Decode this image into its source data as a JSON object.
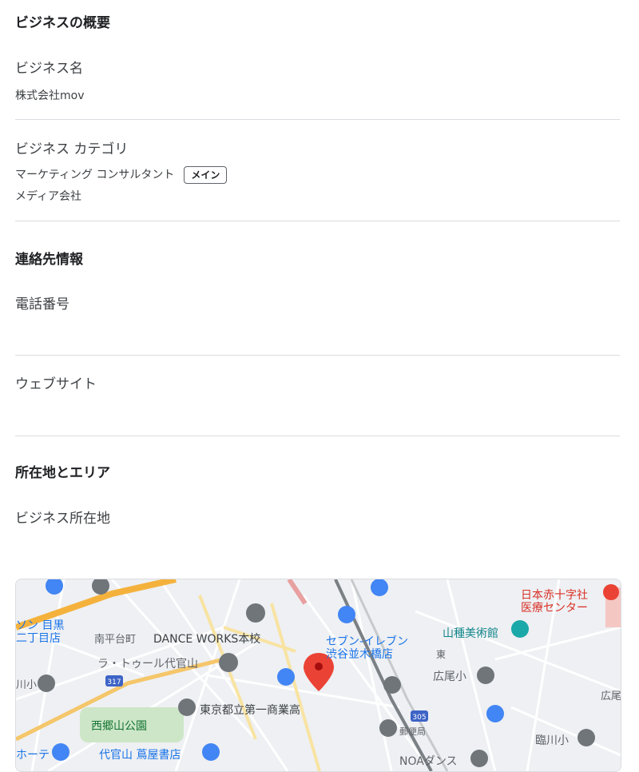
{
  "overview": {
    "title": "ビジネスの概要",
    "business_name_label": "ビジネス名",
    "business_name_value": "株式会社mov",
    "category_label": "ビジネス カテゴリ",
    "primary_category": "マーケティング コンサルタント",
    "primary_badge": "メイン",
    "secondary_category": "メディア会社"
  },
  "contact": {
    "title": "連絡先情報",
    "phone_label": "電話番号",
    "website_label": "ウェブサイト"
  },
  "location": {
    "title": "所在地とエリア",
    "address_label": "ビジネス所在地"
  },
  "map": {
    "labels": {
      "red_cross": "日本赤十字社",
      "red_cross_2": "医療センター",
      "meguro": "ソン 目黒",
      "meguro_2": "二丁目店",
      "minamihiradai": "南平台町",
      "dance": "DANCE WORKS本校",
      "seven": "セブン-イレブン",
      "seven_2": "渋谷並木橋店",
      "higashi": "東",
      "yamatane": "山種美術館",
      "latour": "ラ・トゥール代官山",
      "hiroo_school": "広尾小",
      "hiroo": "広尾",
      "school_left": "川小",
      "route_317": "317",
      "route_305": "305",
      "high_school": "東京都立第一商業高",
      "saigoyama": "西郷山公園",
      "post": "郵便局",
      "rinsen": "臨川小",
      "tsutaya": "代官山 蔦屋書店",
      "hotel": "ホーテ",
      "noa": "NOAダンス"
    },
    "colors": {
      "pin": "#ea4335",
      "poi_blue": "#4285f4",
      "poi_gray": "#70757a",
      "park": "#cde6c7"
    }
  }
}
